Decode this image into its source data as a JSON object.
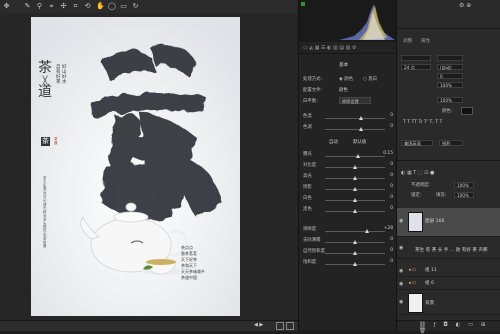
{
  "toolbar": {
    "icons": [
      "move-icon",
      "brush-icon",
      "eyedropper-icon",
      "stamp-icon",
      "spot-heal-icon",
      "crop-icon",
      "transform-icon",
      "hand-icon",
      "ellipse-icon"
    ]
  },
  "poster": {
    "big_char": "茶",
    "title_top": "茶",
    "title_x": "╳",
    "title_bottom": "道",
    "vertical_1": "自有好茶",
    "vertical_2": "好山好水",
    "seal_top": "茶",
    "seal_bottom": "茶道",
    "vertical_small": "茶文化源远流长博大精深茶为国饮品茶悟道",
    "poem": [
      "茶点点",
      "香茶茗茗",
      "天下好茶",
      "茶和天下",
      "天天茶味故乡",
      "茶道中国"
    ]
  },
  "bottom_bar": {
    "nav": "◀ ▶"
  },
  "camera_raw": {
    "header_label": "基本",
    "process_label": "处理方式：",
    "process_color": "颜色",
    "process_bw": "黑白",
    "profile_label": "配置文件：",
    "profile_value": "颜色",
    "wb_label": "白平衡：",
    "wb_value": "原照设置",
    "sliders_a": [
      {
        "label": "色温",
        "value": "0",
        "pos": 0.6
      },
      {
        "label": "色调",
        "value": "0",
        "pos": 0.6
      }
    ],
    "auto_label": "自动",
    "default_label": "默认值",
    "sliders_b": [
      {
        "label": "曝光",
        "value": "0.15",
        "pos": 0.55
      },
      {
        "label": "对比度",
        "value": "0",
        "pos": 0.5
      },
      {
        "label": "高光",
        "value": "0",
        "pos": 0.5
      },
      {
        "label": "阴影",
        "value": "0",
        "pos": 0.5
      },
      {
        "label": "白色",
        "value": "0",
        "pos": 0.5
      },
      {
        "label": "黑色",
        "value": "0",
        "pos": 0.5
      }
    ],
    "sliders_c": [
      {
        "label": "清晰度",
        "value": "+28",
        "pos": 0.7
      },
      {
        "label": "去除薄雾",
        "value": "0",
        "pos": 0.5
      },
      {
        "label": "自然饱和度",
        "value": "0",
        "pos": 0.5
      },
      {
        "label": "饱和度",
        "value": "0",
        "pos": 0.5
      }
    ]
  },
  "dock": {
    "tab_adjust": "调整",
    "tab_props": "属性",
    "font_size": "24 点",
    "leading": "(自动)",
    "tracking": "0",
    "percent_a": "100%",
    "percent_b": "100%",
    "color_label": "颜色：",
    "glyph_buttons": "T T TT Tr T' T, T T",
    "lang": "美国英语",
    "aa": "锐利",
    "opacity_label": "不透明度：",
    "opacity_value": "100%",
    "fill_label": "填充：",
    "fill_value": "100%",
    "lock_label": "锁定：",
    "layers": [
      {
        "name": "图层 166",
        "kind": "photo"
      },
      {
        "name": "茶生 卷 茶 长 手 ... 款 有好 茶 声那",
        "kind": "text"
      },
      {
        "name": "组 11",
        "kind": "group"
      },
      {
        "name": "组 6",
        "kind": "group"
      },
      {
        "name": "背景",
        "kind": "photo"
      }
    ],
    "bottom_icons": [
      "link-icon",
      "fx-icon",
      "mask-icon",
      "adjust-icon",
      "folder-icon",
      "new-layer-icon",
      "trash-icon"
    ]
  }
}
